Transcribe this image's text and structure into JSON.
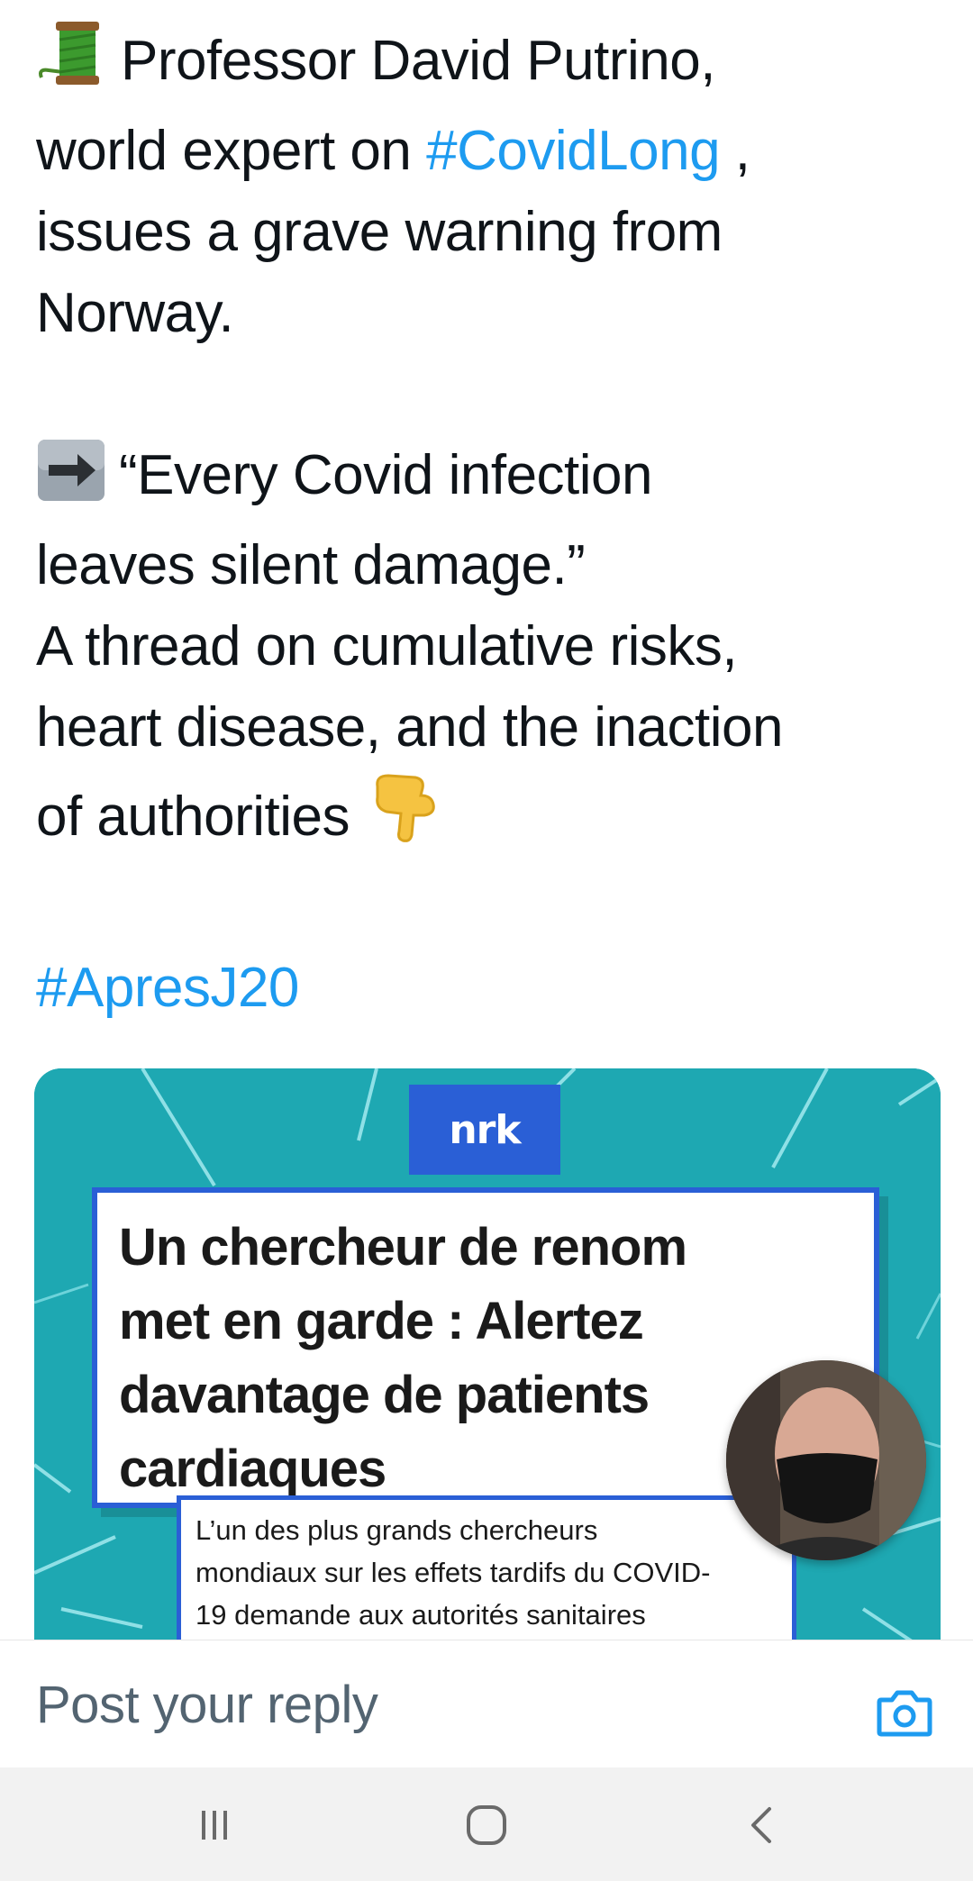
{
  "tweet": {
    "line1": "Professor David Putrino,",
    "line2_prefix": "world expert on ",
    "line2_hashtag": "#CovidLong",
    "line2_suffix": " ,",
    "line3": "issues a grave warning from",
    "line4": "Norway.",
    "quote_line1": "“Every Covid infection",
    "quote_line2": "leaves silent damage.”",
    "line5": "A thread on cumulative risks,",
    "line6": "heart disease, and the inaction",
    "line7": "of authorities",
    "hashtag2": "#ApresJ20"
  },
  "media": {
    "logo": "nrk",
    "headline_lines": [
      "Un chercheur de renom",
      "met en garde : Alertez",
      "davantage de patients",
      "cardiaques"
    ],
    "subtext_lines": [
      "L’un des plus grands chercheurs",
      "mondiaux sur les effets tardifs du COVID-",
      "19 demande aux autorités sanitaires"
    ]
  },
  "reply": {
    "placeholder": "Post your reply",
    "camera_icon": "camera-icon"
  },
  "nav": {
    "icons": [
      "recent-apps-icon",
      "home-icon",
      "back-icon"
    ]
  },
  "colors": {
    "hashtag": "#1d9bf0",
    "nrk_blue": "#2a5fd6",
    "card_teal": "#1ea8b2",
    "placeholder_gray": "#536471"
  }
}
